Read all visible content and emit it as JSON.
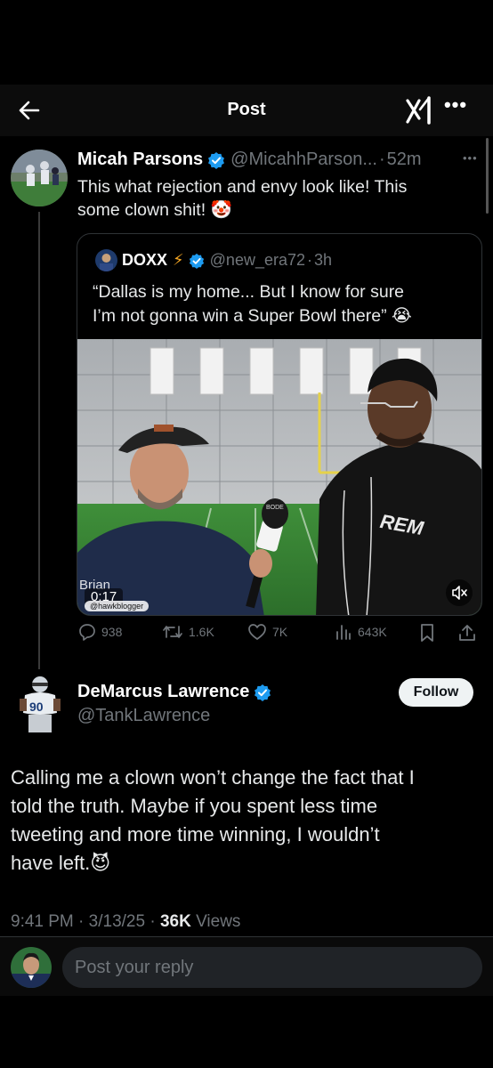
{
  "header": {
    "title": "Post",
    "back_icon": "arrow-left-icon",
    "grok_icon": "grok-icon",
    "more_label": "•••"
  },
  "parent_post": {
    "name": "Micah Parsons",
    "handle": "@MicahhParson...",
    "separator": "·",
    "time": "52m",
    "more_label": "•••",
    "text_line1": "This what rejection and envy look like! This",
    "text_line2": "some clown shit! 🤡",
    "quoted": {
      "name": "DOXX",
      "name_emoji": "⚡",
      "handle": "@new_era72",
      "separator": "·",
      "time": "3h",
      "text_line1": "“Dallas is my home... But I know for sure",
      "text_line2": "I’m not gonna win a Super Bowl there” 😭",
      "video": {
        "overlay_name": "Brian",
        "timer": "0:17",
        "watermark": "@hawkblogger",
        "mic_label": "BODE",
        "hoodie_text": "REM"
      }
    },
    "stats": {
      "replies": "938",
      "reposts": "1.6K",
      "likes": "7K",
      "views": "643K"
    }
  },
  "main_post": {
    "name": "DeMarcus Lawrence",
    "handle": "@TankLawrence",
    "follow_label": "Follow",
    "text_line1": "Calling me a clown won’t change the fact that I",
    "text_line2": "told the truth. Maybe if you spent less time",
    "text_line3": "tweeting and more time winning, I wouldn’t",
    "text_line4": "have left.😈",
    "time": "9:41 PM",
    "date": "3/13/25",
    "separator": "·",
    "views_count": "36K",
    "views_label": "Views"
  },
  "reply": {
    "placeholder": "Post your reply"
  },
  "colors": {
    "verified": "#1d9bf0",
    "text_muted": "#71767b",
    "background": "#000000"
  }
}
